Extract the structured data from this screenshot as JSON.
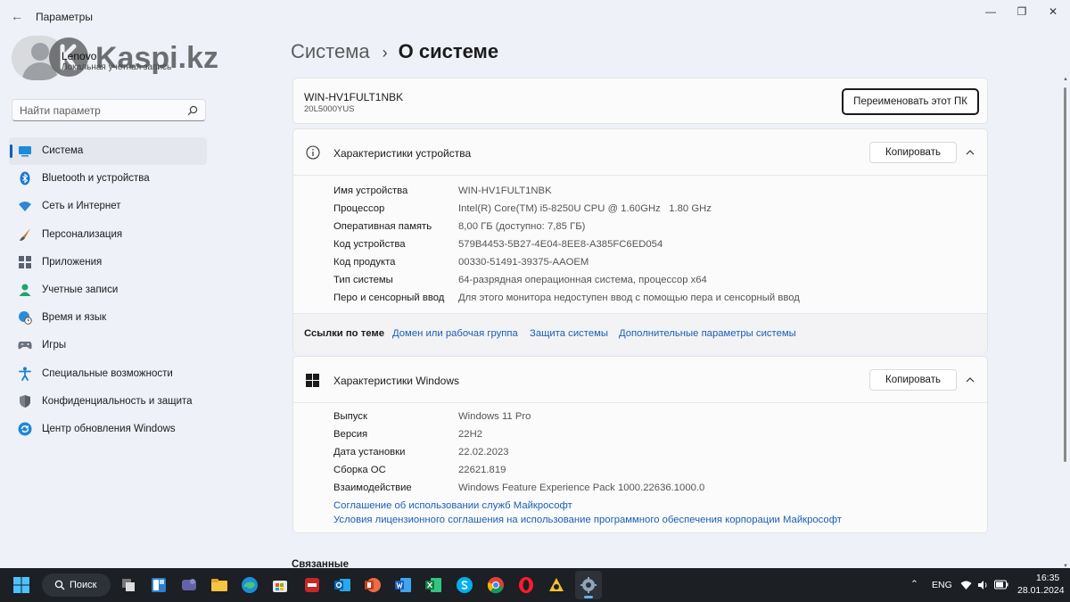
{
  "window": {
    "title": "Параметры",
    "back_glyph": "←",
    "minimize_glyph": "—",
    "maximize_glyph": "❐",
    "close_glyph": "✕"
  },
  "watermark": "Kaspi.kz",
  "profile": {
    "name": "Lenovo",
    "account_type": "Локальная учетная запись"
  },
  "search": {
    "placeholder": "Найти параметр"
  },
  "sidebar": {
    "items": [
      {
        "label": "Система",
        "icon": "system-icon",
        "active": true
      },
      {
        "label": "Bluetooth и устройства",
        "icon": "bluetooth-icon"
      },
      {
        "label": "Сеть и Интернет",
        "icon": "wifi-icon"
      },
      {
        "label": "Персонализация",
        "icon": "brush-icon"
      },
      {
        "label": "Приложения",
        "icon": "apps-icon"
      },
      {
        "label": "Учетные записи",
        "icon": "person-icon"
      },
      {
        "label": "Время и язык",
        "icon": "globe-clock-icon"
      },
      {
        "label": "Игры",
        "icon": "gamepad-icon"
      },
      {
        "label": "Специальные возможности",
        "icon": "accessibility-icon"
      },
      {
        "label": "Конфиденциальность и защита",
        "icon": "shield-icon"
      },
      {
        "label": "Центр обновления Windows",
        "icon": "update-icon"
      }
    ]
  },
  "breadcrumb": {
    "parent": "Система",
    "separator": "›",
    "current": "О системе"
  },
  "pc": {
    "name": "WIN-HV1FULT1NBK",
    "model": "20L5000YUS",
    "rename_label": "Переименовать этот ПК"
  },
  "device_specs": {
    "title": "Характеристики устройства",
    "copy_label": "Копировать",
    "rows": [
      {
        "key": "Имя устройства",
        "value": "WIN-HV1FULT1NBK"
      },
      {
        "key": "Процессор",
        "value": "Intel(R) Core(TM) i5-8250U CPU @ 1.60GHz   1.80 GHz"
      },
      {
        "key": "Оперативная память",
        "value": "8,00 ГБ (доступно: 7,85 ГБ)"
      },
      {
        "key": "Код устройства",
        "value": "579B4453-5B27-4E04-8EE8-A385FC6ED054"
      },
      {
        "key": "Код продукта",
        "value": "00330-51491-39375-AAOEM"
      },
      {
        "key": "Тип системы",
        "value": "64-разрядная операционная система, процессор x64"
      },
      {
        "key": "Перо и сенсорный ввод",
        "value": "Для этого монитора недоступен ввод с помощью пера и сенсорный ввод"
      }
    ]
  },
  "related_links": {
    "title": "Ссылки по теме",
    "links": [
      "Домен или рабочая группа",
      "Защита системы",
      "Дополнительные параметры системы"
    ]
  },
  "windows_specs": {
    "title": "Характеристики Windows",
    "copy_label": "Копировать",
    "rows": [
      {
        "key": "Выпуск",
        "value": "Windows 11 Pro"
      },
      {
        "key": "Версия",
        "value": "22H2"
      },
      {
        "key": "Дата установки",
        "value": "22.02.2023"
      },
      {
        "key": "Сборка ОС",
        "value": "22621.819"
      },
      {
        "key": "Взаимодействие",
        "value": "Windows Feature Experience Pack 1000.22636.1000.0"
      }
    ],
    "links": [
      "Соглашение об использовании служб Майкрософт",
      "Условия лицензионного соглашения на использование программного обеспечения корпорации Майкрософт"
    ]
  },
  "related_section_title": "Связанные",
  "taskbar": {
    "search_label": "Поиск",
    "language": "ENG",
    "time": "16:35",
    "date": "28.01.2024",
    "accent_color": "#5fb2f2"
  },
  "colors": {
    "accent": "#005fb8",
    "link": "#1a5fb4",
    "background": "#eef1f8"
  }
}
